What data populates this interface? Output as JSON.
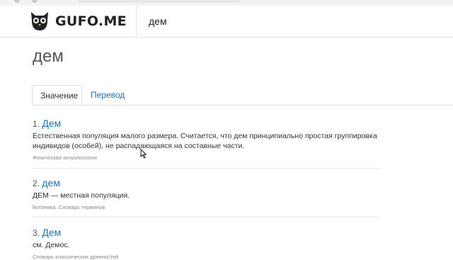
{
  "header": {
    "logo_text": "GUFO.ME",
    "search_value": "дем"
  },
  "page": {
    "title": "дем"
  },
  "tabs": [
    {
      "label": "Значение",
      "active": true
    },
    {
      "label": "Перевод",
      "active": false
    }
  ],
  "entries": [
    {
      "number": "1.",
      "word": "Дем",
      "text": "Естественная популяция малого размера. Считается, что дем принципиально простая группировка индивидов (особей), не распадающаяся на составные части.",
      "source": "Физическая антропология"
    },
    {
      "number": "2.",
      "word": "дем",
      "text": "ДЕМ — местная популяция.",
      "source": "Ботаника. Словарь терминов"
    },
    {
      "number": "3.",
      "word": "Дем",
      "text": "см. Демос.",
      "source": "Словарь классических древностей"
    }
  ],
  "colors": {
    "link": "#1a73b5",
    "text": "#333333",
    "muted": "#888888"
  },
  "icons": [
    "owl-logo-icon",
    "cursor-arrow-icon"
  ]
}
